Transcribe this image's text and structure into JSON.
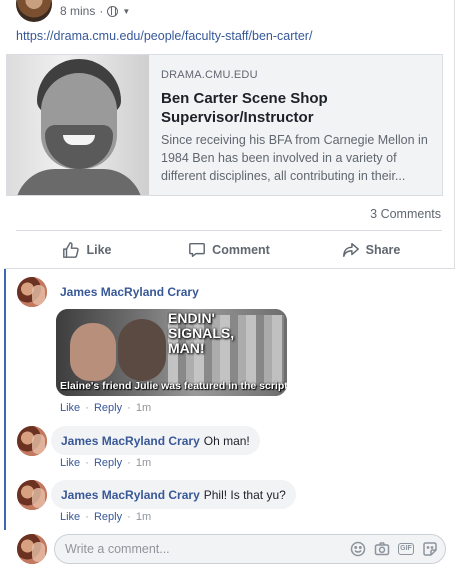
{
  "post": {
    "time": "8 mins",
    "url": "https://drama.cmu.edu/people/faculty-staff/ben-carter/"
  },
  "link_card": {
    "domain": "DRAMA.CMU.EDU",
    "title": "Ben Carter Scene Shop Supervisor/Instructor",
    "description": "Since receiving his BFA from Carnegie Mellon in 1984 Ben has been involved in a variety of different disciplines, all contributing in their..."
  },
  "stats": {
    "comments": "3 Comments"
  },
  "actions": {
    "like": "Like",
    "comment": "Comment",
    "share": "Share"
  },
  "comments": [
    {
      "author": "James MacRyland Crary",
      "text": "",
      "meme_top_text": "ENDIN'\nSIGNALS,\nMAN!",
      "meme_caption": "Elaine's friend Julie was featured in the script",
      "like": "Like",
      "reply": "Reply",
      "time": "1m"
    },
    {
      "author": "James MacRyland Crary",
      "text": "Oh man!",
      "like": "Like",
      "reply": "Reply",
      "time": "1m"
    },
    {
      "author": "James MacRyland Crary",
      "text": "Phil! Is that yu?",
      "like": "Like",
      "reply": "Reply",
      "time": "1m"
    }
  ],
  "composer": {
    "placeholder": "Write a comment...",
    "icons": [
      "emoji-icon",
      "camera-icon",
      "gif-icon",
      "sticker-icon"
    ]
  },
  "colors": {
    "link": "#365899",
    "author": "#385898",
    "accent_bar": "#4267b2"
  }
}
